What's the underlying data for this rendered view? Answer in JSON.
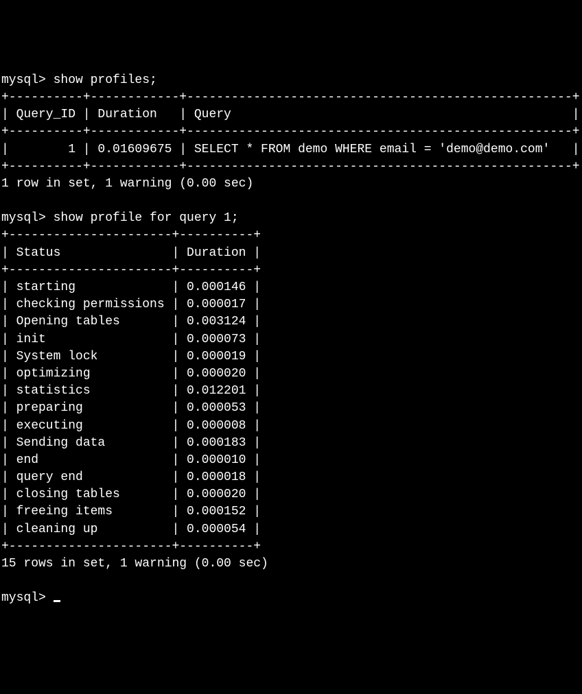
{
  "prompt1": "mysql> show profiles;",
  "table1": {
    "top_border": "+----------+------------+----------------------------------------------------+",
    "header": "| Query_ID | Duration   | Query                                              |",
    "header_border": "+----------+------------+----------------------------------------------------+",
    "row1": "|        1 | 0.01609675 | SELECT * FROM demo WHERE email = 'demo@demo.com'   |",
    "bottom_border": "+----------+------------+----------------------------------------------------+"
  },
  "result1": "1 row in set, 1 warning (0.00 sec)",
  "blank": "",
  "prompt2": "mysql> show profile for query 1;",
  "table2": {
    "top_border": "+----------------------+----------+",
    "header": "| Status               | Duration |",
    "header_border": "+----------------------+----------+",
    "rows": [
      "| starting             | 0.000146 |",
      "| checking permissions | 0.000017 |",
      "| Opening tables       | 0.003124 |",
      "| init                 | 0.000073 |",
      "| System lock          | 0.000019 |",
      "| optimizing           | 0.000020 |",
      "| statistics           | 0.012201 |",
      "| preparing            | 0.000053 |",
      "| executing            | 0.000008 |",
      "| Sending data         | 0.000183 |",
      "| end                  | 0.000010 |",
      "| query end            | 0.000018 |",
      "| closing tables       | 0.000020 |",
      "| freeing items        | 0.000152 |",
      "| cleaning up          | 0.000054 |"
    ],
    "bottom_border": "+----------------------+----------+"
  },
  "result2": "15 rows in set, 1 warning (0.00 sec)",
  "prompt3": "mysql> ",
  "chart_data": {
    "type": "table",
    "tables": [
      {
        "title": "show profiles",
        "columns": [
          "Query_ID",
          "Duration",
          "Query"
        ],
        "rows": [
          [
            1,
            0.01609675,
            "SELECT * FROM demo WHERE email = 'demo@demo.com'"
          ]
        ]
      },
      {
        "title": "show profile for query 1",
        "columns": [
          "Status",
          "Duration"
        ],
        "rows": [
          [
            "starting",
            0.000146
          ],
          [
            "checking permissions",
            1.7e-05
          ],
          [
            "Opening tables",
            0.003124
          ],
          [
            "init",
            7.3e-05
          ],
          [
            "System lock",
            1.9e-05
          ],
          [
            "optimizing",
            2e-05
          ],
          [
            "statistics",
            0.012201
          ],
          [
            "preparing",
            5.3e-05
          ],
          [
            "executing",
            8e-06
          ],
          [
            "Sending data",
            0.000183
          ],
          [
            "end",
            1e-05
          ],
          [
            "query end",
            1.8e-05
          ],
          [
            "closing tables",
            2e-05
          ],
          [
            "freeing items",
            0.000152
          ],
          [
            "cleaning up",
            5.4e-05
          ]
        ]
      }
    ]
  }
}
